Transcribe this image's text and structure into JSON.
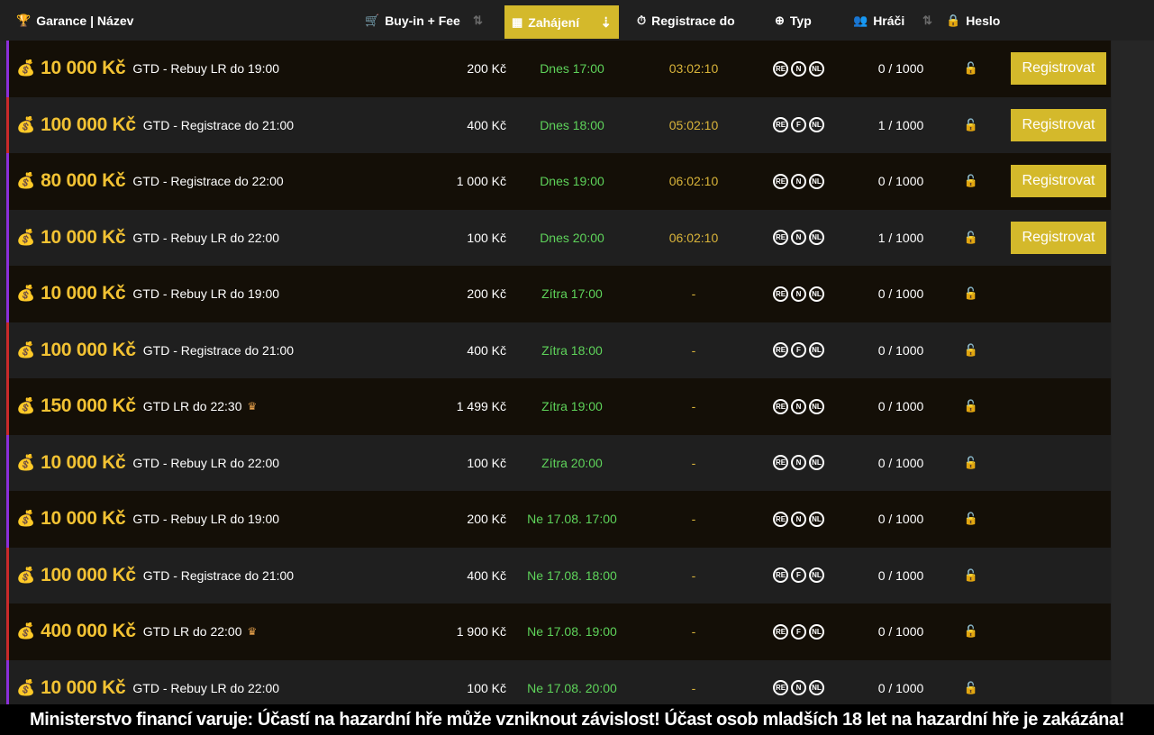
{
  "header": {
    "garance": {
      "label": "Garance | Název",
      "icon": "trophy-icon"
    },
    "buyin": {
      "label": "Buy-in + Fee",
      "icon": "cart-icon"
    },
    "start": {
      "label": "Zahájení",
      "icon": "calendar-icon"
    },
    "registration": {
      "label": "Registrace do",
      "icon": "stopwatch-icon"
    },
    "type": {
      "label": "Typ",
      "icon": "plus-circle-icon"
    },
    "players": {
      "label": "Hráči",
      "icon": "users-icon"
    },
    "password": {
      "label": "Heslo",
      "icon": "lock-icon"
    }
  },
  "colors": {
    "accent": "#d4b92b",
    "amount": "#f2c233",
    "start": "#5ed35a",
    "countdown": "#d9b43a",
    "purple": "#8b2fd9",
    "red": "#c92a2a"
  },
  "register_label": "Registrovat",
  "warning": "Ministerstvo financí varuje: Účastí na hazardní hře může vzniknout závislost! Účast osob mladších 18 let na hazardní hře je zakázána!",
  "tournaments": [
    {
      "amount": "10 000 Kč",
      "title": "GTD - Rebuy LR do 19:00",
      "buyin": "200 Kč",
      "start": "Dnes 17:00",
      "reg": "03:02:10",
      "types": [
        "RE",
        "N",
        "NL"
      ],
      "players": "0 / 1000",
      "register": true,
      "crown": false,
      "accent": "purple"
    },
    {
      "amount": "100 000 Kč",
      "title": "GTD - Registrace do 21:00",
      "buyin": "400 Kč",
      "start": "Dnes 18:00",
      "reg": "05:02:10",
      "types": [
        "RE",
        "F",
        "NL"
      ],
      "players": "1 / 1000",
      "register": true,
      "crown": false,
      "accent": "red"
    },
    {
      "amount": "80 000 Kč",
      "title": "GTD - Registrace do 22:00",
      "buyin": "1 000 Kč",
      "start": "Dnes 19:00",
      "reg": "06:02:10",
      "types": [
        "RE",
        "N",
        "NL"
      ],
      "players": "0 / 1000",
      "register": true,
      "crown": false,
      "accent": "purple"
    },
    {
      "amount": "10 000 Kč",
      "title": "GTD - Rebuy LR do 22:00",
      "buyin": "100 Kč",
      "start": "Dnes 20:00",
      "reg": "06:02:10",
      "types": [
        "RE",
        "N",
        "NL"
      ],
      "players": "1 / 1000",
      "register": true,
      "crown": false,
      "accent": "purple"
    },
    {
      "amount": "10 000 Kč",
      "title": "GTD - Rebuy LR do 19:00",
      "buyin": "200 Kč",
      "start": "Zítra 17:00",
      "reg": "-",
      "types": [
        "RE",
        "N",
        "NL"
      ],
      "players": "0 / 1000",
      "register": false,
      "crown": false,
      "accent": "purple"
    },
    {
      "amount": "100 000 Kč",
      "title": "GTD - Registrace do 21:00",
      "buyin": "400 Kč",
      "start": "Zítra 18:00",
      "reg": "-",
      "types": [
        "RE",
        "F",
        "NL"
      ],
      "players": "0 / 1000",
      "register": false,
      "crown": false,
      "accent": "red"
    },
    {
      "amount": "150 000 Kč",
      "title": "GTD LR do 22:30",
      "buyin": "1 499 Kč",
      "start": "Zítra 19:00",
      "reg": "-",
      "types": [
        "RE",
        "N",
        "NL"
      ],
      "players": "0 / 1000",
      "register": false,
      "crown": true,
      "accent": "red"
    },
    {
      "amount": "10 000 Kč",
      "title": "GTD - Rebuy LR do 22:00",
      "buyin": "100 Kč",
      "start": "Zítra 20:00",
      "reg": "-",
      "types": [
        "RE",
        "N",
        "NL"
      ],
      "players": "0 / 1000",
      "register": false,
      "crown": false,
      "accent": "purple"
    },
    {
      "amount": "10 000 Kč",
      "title": "GTD - Rebuy LR do 19:00",
      "buyin": "200 Kč",
      "start": "Ne 17.08. 17:00",
      "reg": "-",
      "types": [
        "RE",
        "N",
        "NL"
      ],
      "players": "0 / 1000",
      "register": false,
      "crown": false,
      "accent": "purple"
    },
    {
      "amount": "100 000 Kč",
      "title": "GTD - Registrace do 21:00",
      "buyin": "400 Kč",
      "start": "Ne 17.08. 18:00",
      "reg": "-",
      "types": [
        "RE",
        "F",
        "NL"
      ],
      "players": "0 / 1000",
      "register": false,
      "crown": false,
      "accent": "red"
    },
    {
      "amount": "400 000 Kč",
      "title": "GTD LR do 22:00",
      "buyin": "1 900 Kč",
      "start": "Ne 17.08. 19:00",
      "reg": "-",
      "types": [
        "RE",
        "F",
        "NL"
      ],
      "players": "0 / 1000",
      "register": false,
      "crown": true,
      "accent": "red"
    },
    {
      "amount": "10 000 Kč",
      "title": "GTD - Rebuy LR do 22:00",
      "buyin": "100 Kč",
      "start": "Ne 17.08. 20:00",
      "reg": "-",
      "types": [
        "RE",
        "N",
        "NL"
      ],
      "players": "0 / 1000",
      "register": false,
      "crown": false,
      "accent": "purple"
    }
  ]
}
